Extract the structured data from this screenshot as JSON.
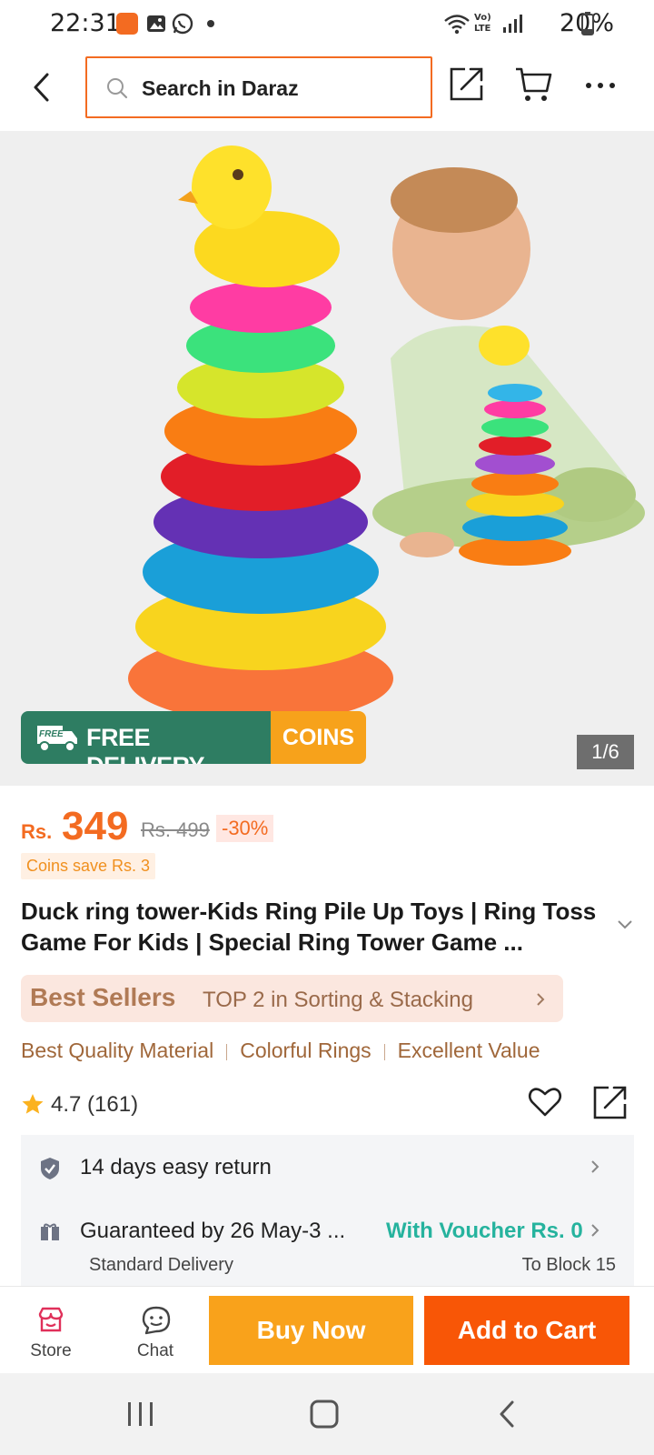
{
  "status_bar": {
    "time": "22:31",
    "network": "Vo) LTE",
    "battery": "20%",
    "icons": [
      "app-notification-icon",
      "gallery-icon",
      "whatsapp-icon",
      "dot-icon",
      "wifi-icon",
      "signal-icon",
      "battery-icon"
    ]
  },
  "header": {
    "search_placeholder": "Search in Daraz",
    "icons": [
      "back-icon",
      "search-icon",
      "share-icon",
      "cart-icon",
      "more-icon"
    ]
  },
  "gallery": {
    "pager": "1/6",
    "promo_free_badge": "FREE",
    "promo_free_label": "FREE DELIVERY",
    "promo_coins_label": "COINS"
  },
  "product": {
    "currency": "Rs.",
    "price": "349",
    "old_price": "Rs. 499",
    "discount": "-30%",
    "coins_save": "Coins save Rs. 3",
    "title": "Duck ring tower-Kids Ring Pile Up Toys | Ring Toss Game For Kids | Special Ring Tower Game ...",
    "best_sellers_label": "Best Sellers",
    "best_sellers_rank": "TOP 2 in Sorting & Stacking",
    "tags": [
      "Best Quality Material",
      "Colorful Rings",
      "Excellent Value"
    ],
    "rating": "4.7 (161)"
  },
  "services": {
    "return_text": "14 days easy return",
    "delivery_text": "Guaranteed by 26 May-3 ...",
    "voucher_text": "With Voucher Rs. 0",
    "delivery_type": "Standard Delivery",
    "delivery_location": "To Block 15"
  },
  "action_bar": {
    "store_label": "Store",
    "chat_label": "Chat",
    "buy_now_label": "Buy Now",
    "add_to_cart_label": "Add to Cart"
  },
  "colors": {
    "brand_orange": "#f85606",
    "buy_now": "#f9a21b",
    "free_delivery_green": "#2e7d62",
    "voucher_teal": "#26b39e",
    "best_sellers_bg": "#fbe7df"
  }
}
